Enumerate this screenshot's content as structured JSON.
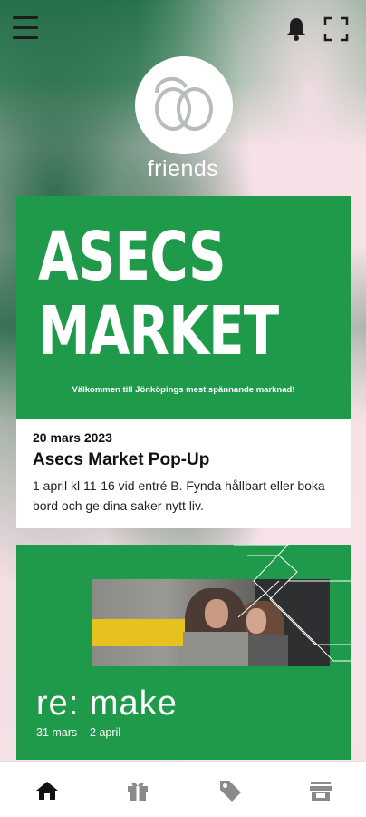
{
  "colors": {
    "brand_green": "#1f9a4b",
    "dark_green": "#1f6a45",
    "pink_bg": "#f6e2e7",
    "icon_dark": "#1d1d1d",
    "nav_inactive": "#8a8a8a"
  },
  "topbar": {
    "menu_icon": "hamburger-menu-icon",
    "bell_icon": "bell-icon",
    "fullscreen_icon": "fullscreen-icon"
  },
  "logo": {
    "label": "friends"
  },
  "card_event": {
    "hero_title_line1": "ASECS",
    "hero_title_line2": "MARKET",
    "hero_subtitle": "Välkommen till Jönköpings mest spännande marknad!",
    "date": "20 mars 2023",
    "title": "Asecs Market Pop-Up",
    "description": "1 april kl 11-16 vid entré B. Fynda hållbart eller boka bord och ge dina saker nytt liv."
  },
  "card_remake": {
    "title": "re: make",
    "date": "31 mars – 2 april"
  },
  "bottom_nav": {
    "items": [
      {
        "icon": "home-icon",
        "active": true
      },
      {
        "icon": "gift-icon",
        "active": false
      },
      {
        "icon": "tag-icon",
        "active": false
      },
      {
        "icon": "store-icon",
        "active": false
      }
    ]
  }
}
